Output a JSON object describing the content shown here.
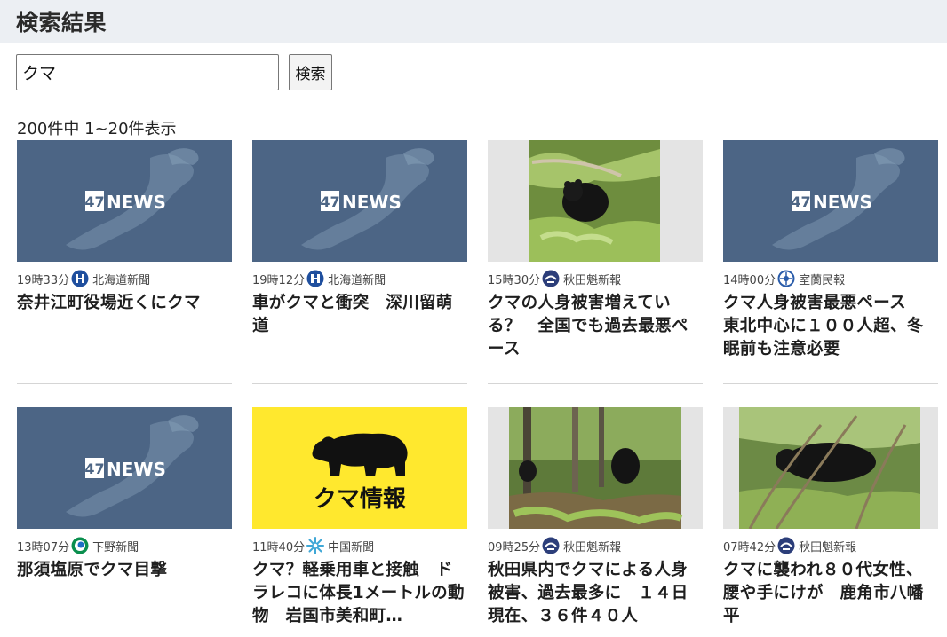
{
  "page": {
    "title": "検索結果"
  },
  "search": {
    "value": "クマ",
    "button_label": "検索"
  },
  "result_count": "200件中 1~20件表示",
  "cards": [
    {
      "time": "19時33分",
      "source": "北海道新聞",
      "source_icon": "hokkaido-shimbun-logo-icon",
      "thumb": "47news",
      "title": "奈井江町役場近くにクマ"
    },
    {
      "time": "19時12分",
      "source": "北海道新聞",
      "source_icon": "hokkaido-shimbun-logo-icon",
      "thumb": "47news",
      "title": "車がクマと衝突　深川留萌道"
    },
    {
      "time": "15時30分",
      "source": "秋田魁新報",
      "source_icon": "akita-sakigake-logo-icon",
      "thumb": "bear-photo",
      "title": "クマの人身被害増えている？　全国でも過去最悪ペース"
    },
    {
      "time": "14時00分",
      "source": "室蘭民報",
      "source_icon": "muroran-minpo-logo-icon",
      "thumb": "47news",
      "title": "クマ人身被害最悪ペース　東北中心に１００人超、冬眠前も注意必要"
    },
    {
      "time": "13時07分",
      "source": "下野新聞",
      "source_icon": "shimotsuke-logo-icon",
      "thumb": "47news",
      "title": "那須塩原でクマ目撃"
    },
    {
      "time": "11時40分",
      "source": "中国新聞",
      "source_icon": "chugoku-shimbun-logo-icon",
      "thumb": "bear-info",
      "thumb_text": "クマ情報",
      "title": "クマ？軽乗用車と接触　ドラレコに体長1メートルの動物　岩国市美和町…"
    },
    {
      "time": "09時25分",
      "source": "秋田魁新報",
      "source_icon": "akita-sakigake-logo-icon",
      "thumb": "bear-forest-photo",
      "title": "秋田県内でクマによる人身被害、過去最多に　１４日現在、３６件４０人"
    },
    {
      "time": "07時42分",
      "source": "秋田魁新報",
      "source_icon": "akita-sakigake-logo-icon",
      "thumb": "bear-bush-photo",
      "title": "クマに襲われ８０代女性、腰や手にけが　鹿角市八幡平"
    }
  ],
  "thumb_logo": {
    "num": "47",
    "word": "NEWS"
  },
  "colors": {
    "header_bg": "#eceff3",
    "bear_info_bg": "#ffe82e",
    "news_bg": "#4c6585"
  }
}
